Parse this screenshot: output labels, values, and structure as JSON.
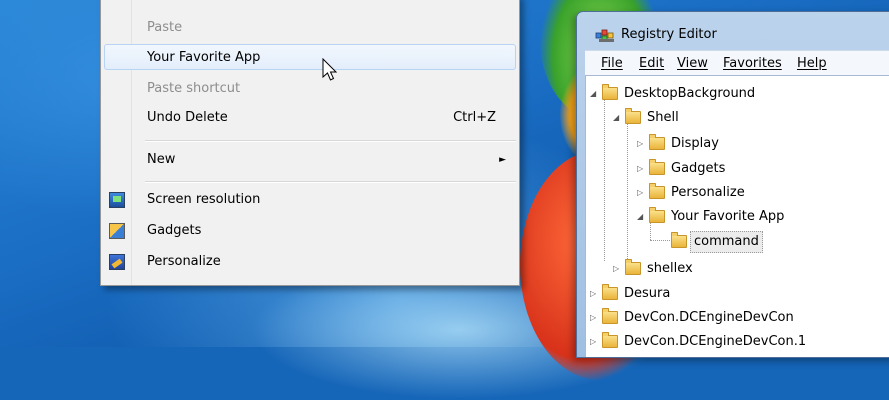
{
  "context_menu": {
    "items": [
      {
        "label": "Paste",
        "state": "disabled"
      },
      {
        "label": "Your Favorite App",
        "state": "hover"
      },
      {
        "label": "Paste shortcut",
        "state": "disabled"
      },
      {
        "label": "Undo Delete",
        "shortcut": "Ctrl+Z"
      },
      {
        "label": "New",
        "submenu_arrow": "►"
      },
      {
        "label": "Screen resolution",
        "icon": "screen-resolution-icon"
      },
      {
        "label": "Gadgets",
        "icon": "gadgets-icon"
      },
      {
        "label": "Personalize",
        "icon": "personalize-icon"
      }
    ]
  },
  "registry_editor": {
    "title": "Registry Editor",
    "menu": [
      "File",
      "Edit",
      "View",
      "Favorites",
      "Help"
    ],
    "tree": [
      {
        "label": "DesktopBackground",
        "expander": "◢"
      },
      {
        "label": "Shell",
        "expander": "◢"
      },
      {
        "label": "Display",
        "expander": "▷"
      },
      {
        "label": "Gadgets",
        "expander": "▷"
      },
      {
        "label": "Personalize",
        "expander": "▷"
      },
      {
        "label": "Your Favorite App",
        "expander": "◢"
      },
      {
        "label": "command",
        "selected": true
      },
      {
        "label": "shellex",
        "expander": "▷"
      },
      {
        "label": "Desura",
        "expander": "▷"
      },
      {
        "label": "DevCon.DCEngineDevCon",
        "expander": "▷"
      },
      {
        "label": "DevCon.DCEngineDevCon.1",
        "expander": "▷"
      }
    ]
  },
  "colors": {
    "menu_bg": "#f1f1f1",
    "hover_border": "#b8d3f3",
    "window_frame": "#bcd3ec",
    "folder": "#e9b43a"
  }
}
